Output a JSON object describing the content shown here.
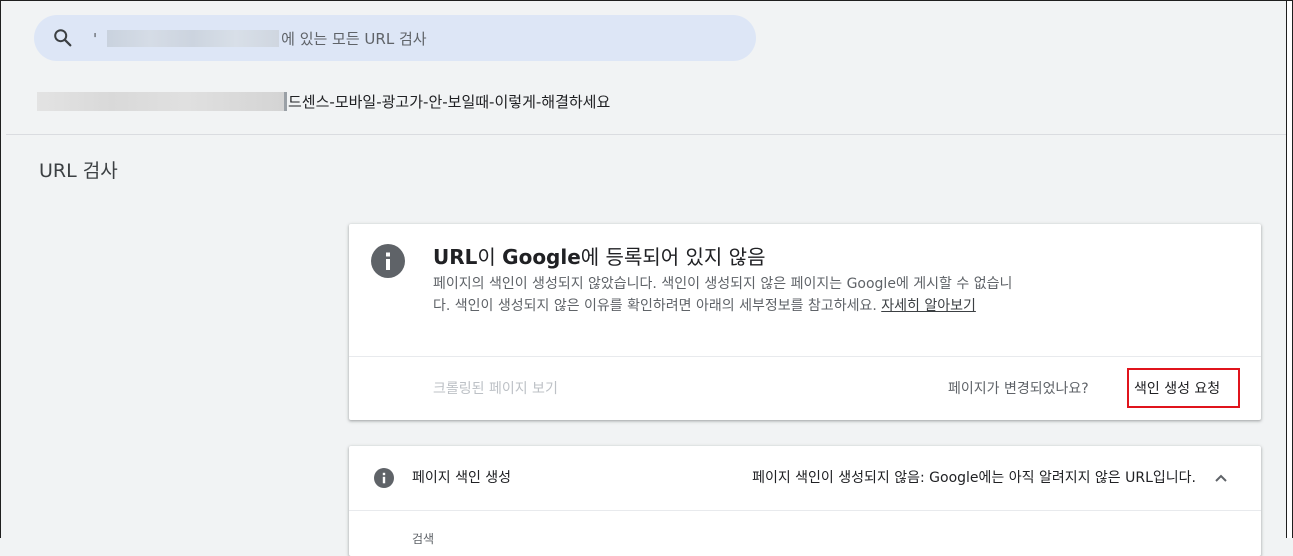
{
  "search": {
    "quote": "'",
    "suffix": "에 있는 모든 URL 검사"
  },
  "url": {
    "path_visible": "드센스-모바일-광고가-안-보일때-이렇게-해결하세요"
  },
  "page_title": "URL 검사",
  "status_card": {
    "title_prefix": "URL",
    "title_mid": "이 ",
    "title_brand": "Google",
    "title_suffix": "에 등록되어 있지 않음",
    "description": "페이지의 색인이 생성되지 않았습니다. 색인이 생성되지 않은 페이지는 Google에 게시할 수 없습니다. 색인이 생성되지 않은 이유를 확인하려면 아래의 세부정보를 참고하세요. ",
    "learn_more": "자세히 알아보기",
    "view_crawled": "크롤링된 페이지 보기",
    "page_changed_question": "페이지가 변경되었나요?",
    "request_indexing": "색인 생성 요청"
  },
  "coverage_card": {
    "label": "페이지 색인 생성",
    "status": "페이지 색인이 생성되지 않음: Google에는 아직 알려지지 않은 URL입니다.",
    "sub_label": "검색"
  },
  "icons": {
    "search": "search-icon",
    "info": "info-icon",
    "chevron": "chevron-up-icon"
  },
  "colors": {
    "highlight_box": "#e0141c",
    "search_bg": "#dde6f6",
    "page_bg": "#f1f3f4"
  }
}
